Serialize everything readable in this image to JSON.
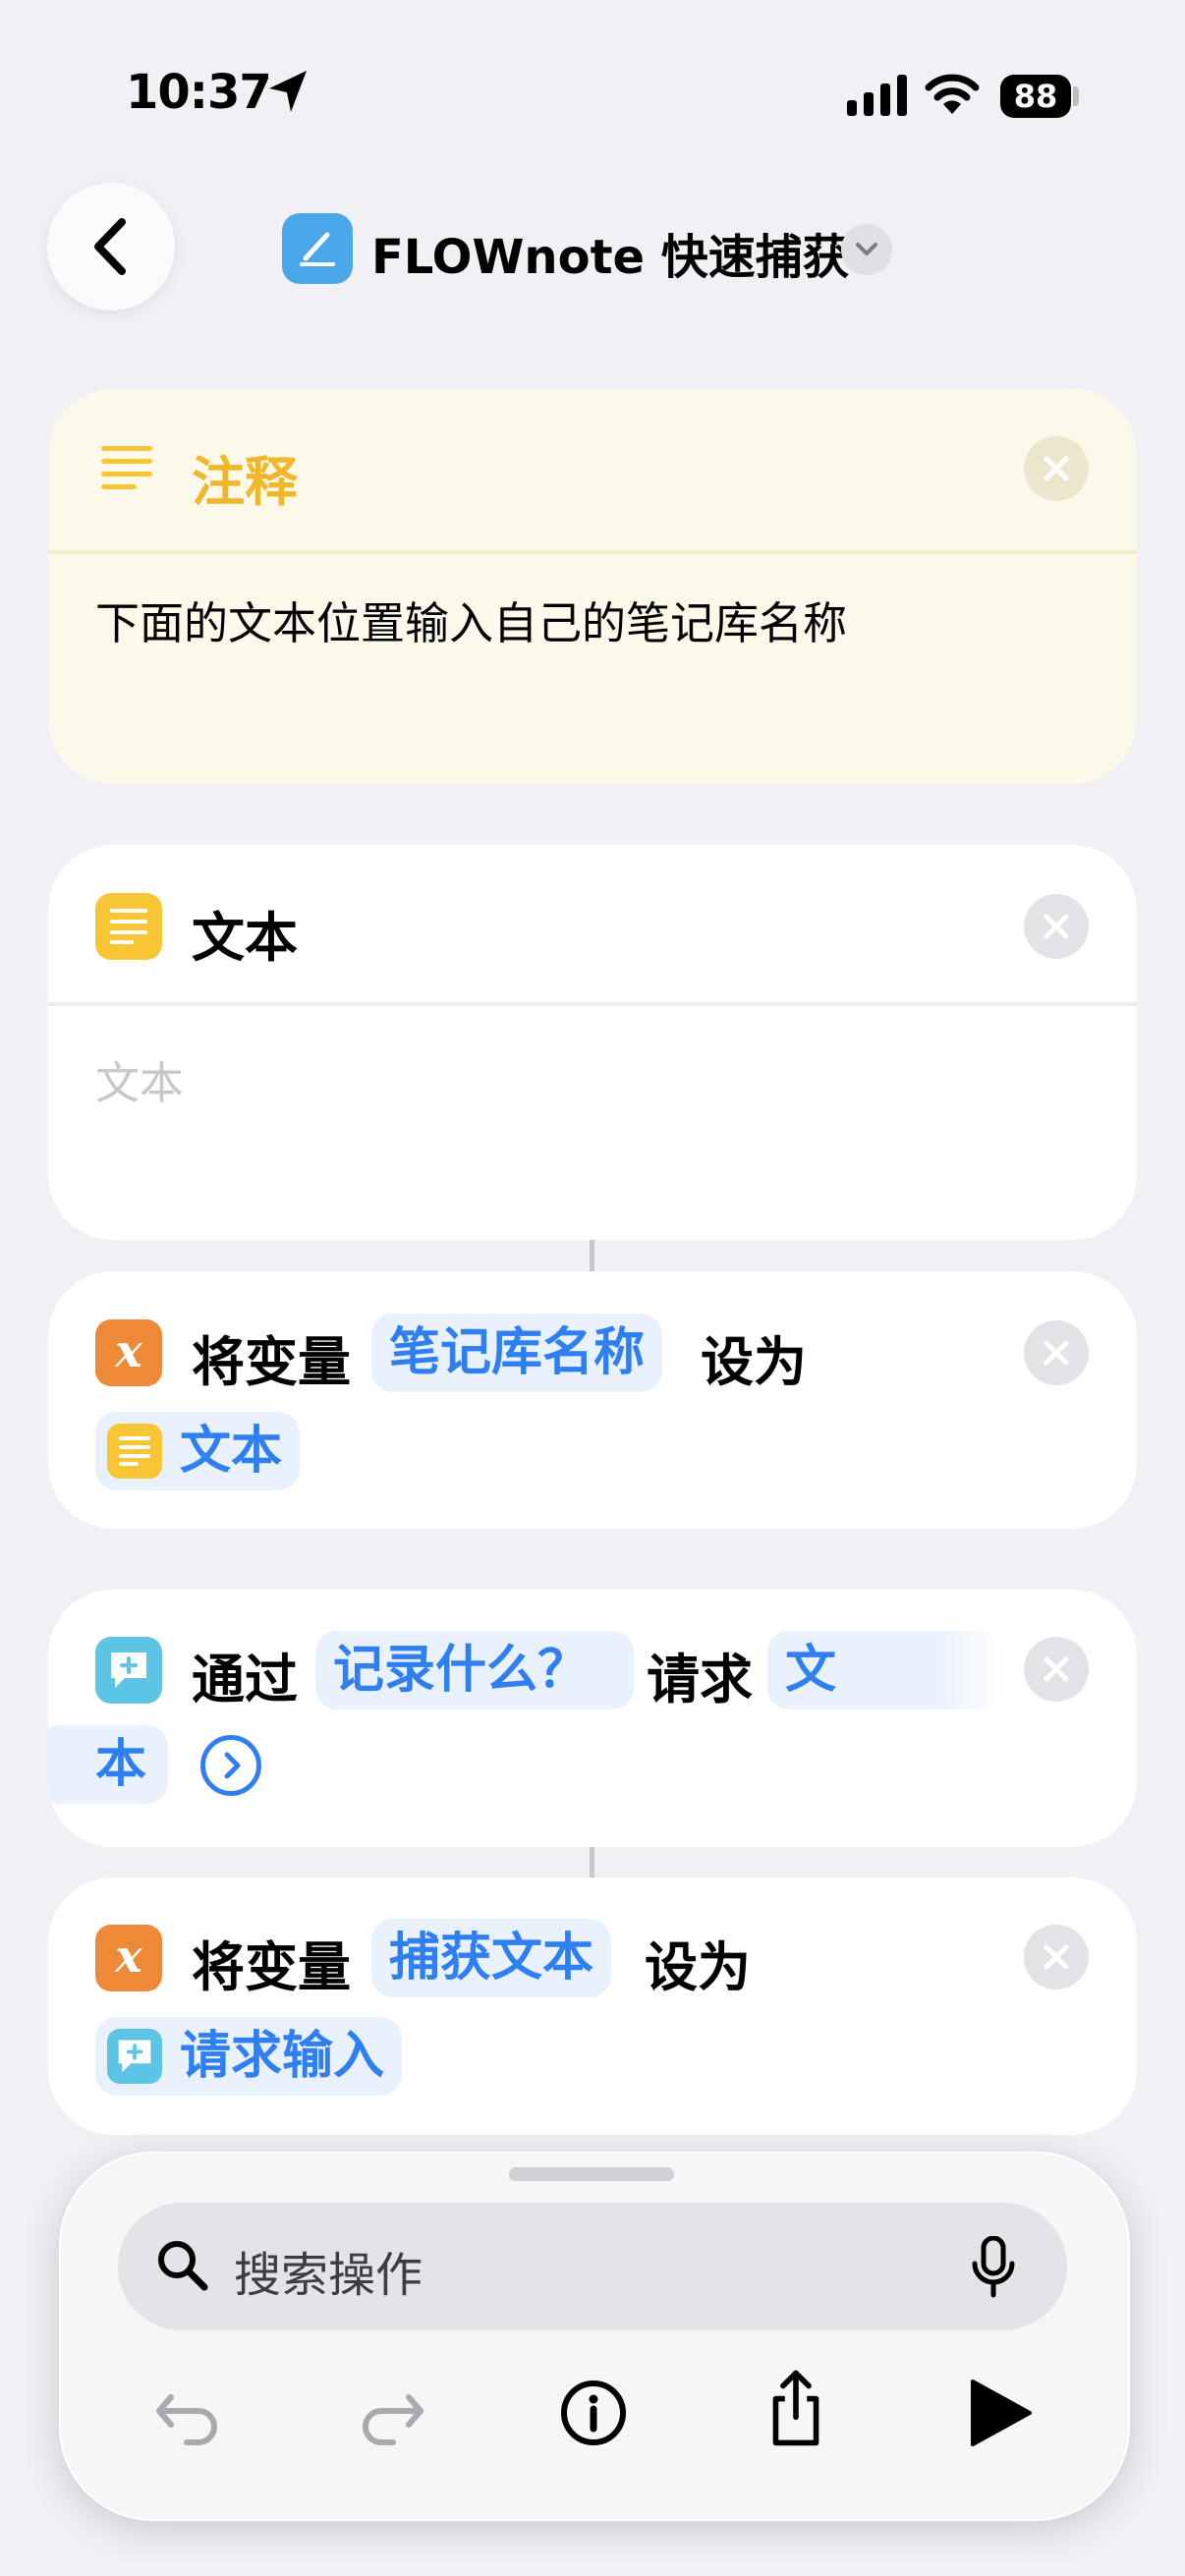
{
  "status_bar": {
    "time": "10:37",
    "battery": "88"
  },
  "nav": {
    "title": "FLOWnote 快速捕获"
  },
  "comment_card": {
    "header": "注释",
    "body": "下面的文本位置输入自己的笔记库名称"
  },
  "text_card": {
    "header": "文本",
    "placeholder": "文本"
  },
  "set_variable_1": {
    "prefix": "将变量",
    "variable": "笔记库名称",
    "middle": "设为",
    "value": "文本"
  },
  "ask_input": {
    "prefix": "通过",
    "prompt": "记录什么？",
    "middle": "请求",
    "type_part1": "文",
    "type_part2": "本"
  },
  "set_variable_2": {
    "prefix": "将变量",
    "variable": "捕获文本",
    "middle": "设为",
    "value": "请求输入"
  },
  "bottom_sheet": {
    "search_placeholder": "搜索操作"
  },
  "colors": {
    "link_blue": "#2f7ff2",
    "comment_yellow": "#f8c635",
    "variable_orange": "#ee8a37",
    "ask_teal": "#5cc4e4"
  }
}
